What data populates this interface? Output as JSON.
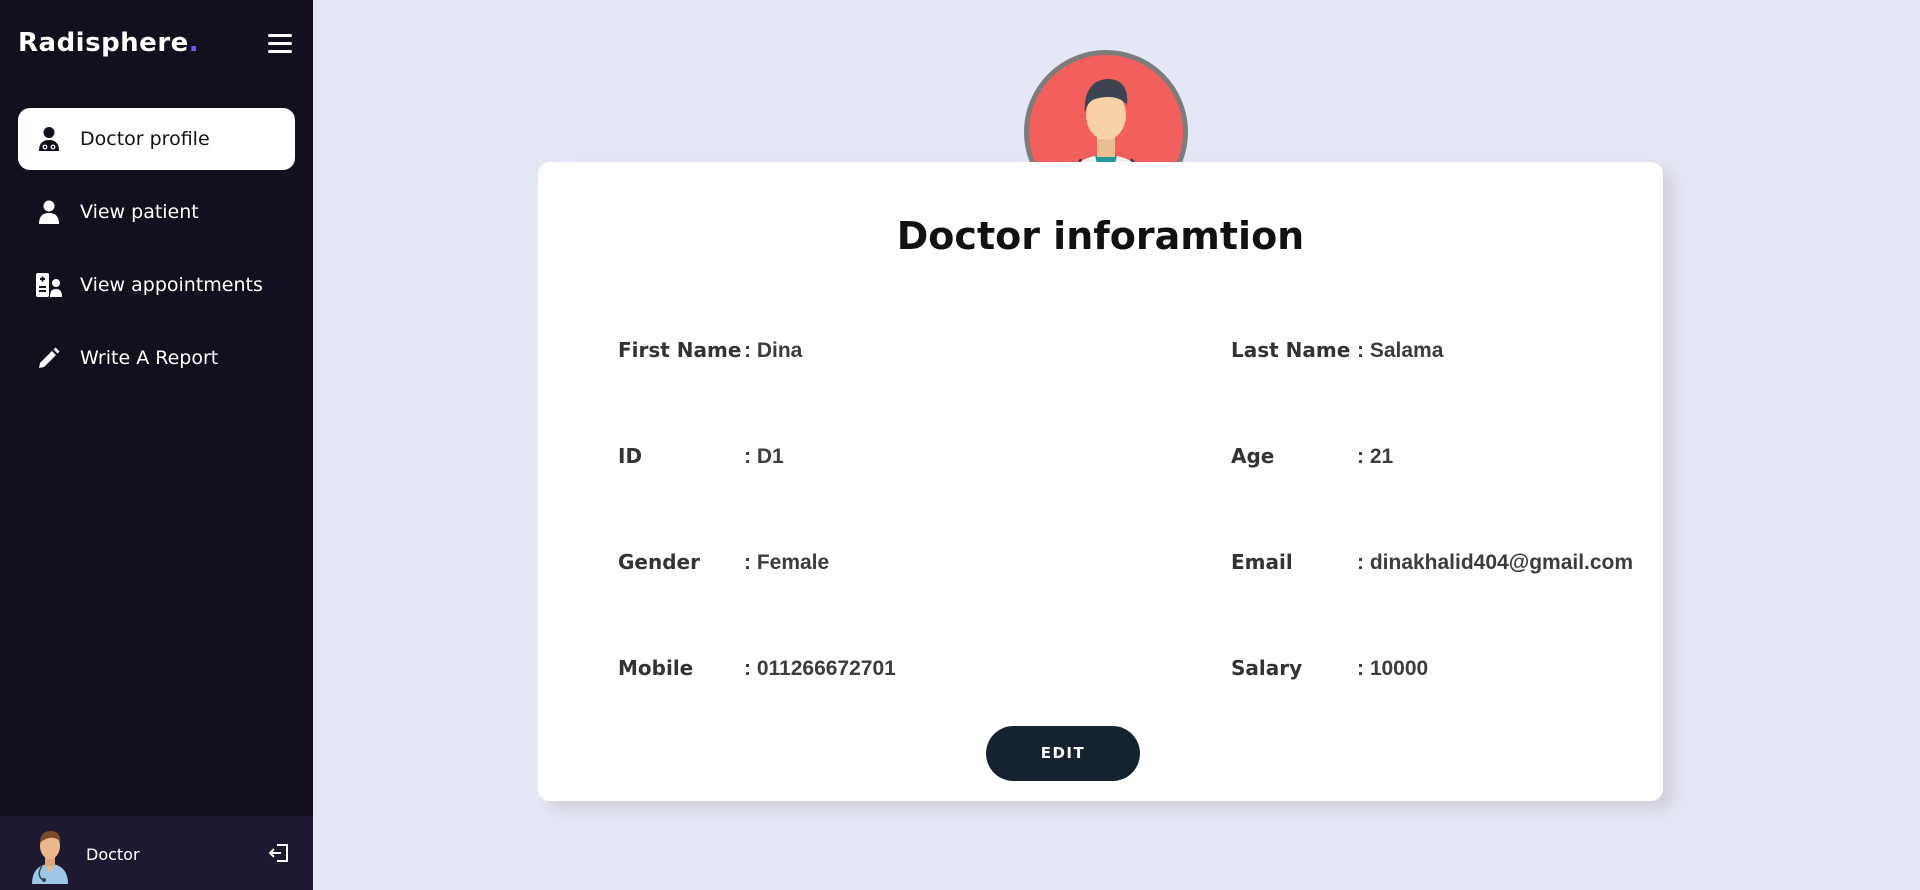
{
  "app": {
    "logo_text": "Radisphere",
    "logo_dot": "."
  },
  "sidebar": {
    "items": [
      {
        "label": "Doctor profile",
        "icon": "doctor-icon",
        "active": true
      },
      {
        "label": "View patient",
        "icon": "user-icon",
        "active": false
      },
      {
        "label": "View appointments",
        "icon": "appointment-icon",
        "active": false
      },
      {
        "label": "Write A Report",
        "icon": "pencil-icon",
        "active": false
      }
    ],
    "user": {
      "name": "Doctor"
    }
  },
  "card": {
    "title": "Doctor inforamtion",
    "fields": {
      "first_name": {
        "label": "First Name",
        "value": ": Dina"
      },
      "last_name": {
        "label": "Last Name",
        "value": ": Salama"
      },
      "id": {
        "label": "ID",
        "value": ": D1"
      },
      "age": {
        "label": "Age",
        "value": ": 21"
      },
      "gender": {
        "label": "Gender",
        "value": ": Female"
      },
      "email": {
        "label": "Email",
        "value": ": dinakhalid404@gmail.com"
      },
      "mobile": {
        "label": "Mobile",
        "value": ": 011266672701"
      },
      "salary": {
        "label": "Salary",
        "value": ": 10000"
      }
    },
    "edit_label": "EDIT"
  },
  "colors": {
    "sidebar_bg": "#12101f",
    "page_bg": "#e4e7f6",
    "accent": "#6a5cff",
    "button": "#152230",
    "avatar_bg": "#f25f5c"
  }
}
